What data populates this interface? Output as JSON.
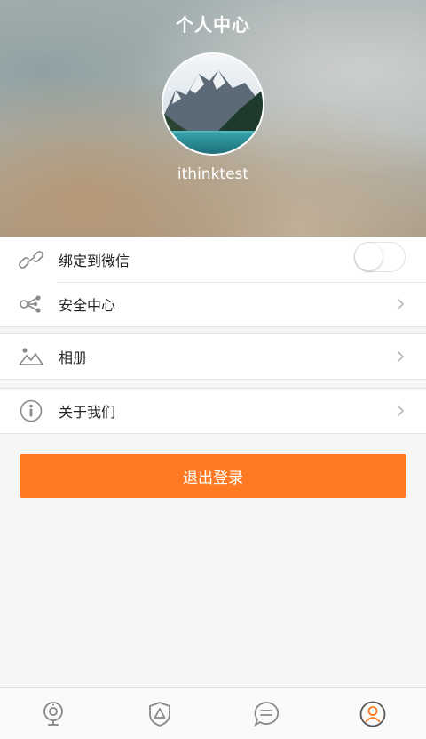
{
  "header": {
    "title": "个人中心",
    "username": "ithinktest"
  },
  "menu": {
    "wechat": {
      "label": "绑定到微信",
      "icon": "link-icon",
      "toggle_on": false
    },
    "security": {
      "label": "安全中心",
      "icon": "share-nodes-icon"
    },
    "album": {
      "label": "相册",
      "icon": "landscape-icon"
    },
    "about": {
      "label": "关于我们",
      "icon": "info-icon"
    }
  },
  "logout_label": "退出登录",
  "tabbar": {
    "items": [
      {
        "icon": "camera-icon",
        "active": false
      },
      {
        "icon": "shield-icon",
        "active": false
      },
      {
        "icon": "chat-icon",
        "active": false
      },
      {
        "icon": "user-icon",
        "active": true
      }
    ]
  },
  "colors": {
    "accent": "#ff7a22",
    "icon_gray": "#8a8a8a",
    "background": "#f5f5f5"
  }
}
